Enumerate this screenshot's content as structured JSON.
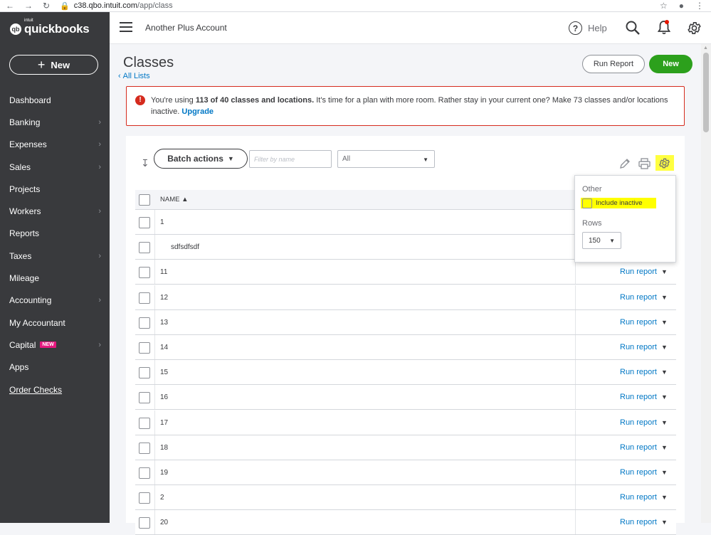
{
  "browser": {
    "host": "c38.qbo.intuit.com",
    "path": "/app/class"
  },
  "brand": {
    "intuit": "intuit",
    "wordmark": "quickbooks",
    "badge": "qb"
  },
  "sidebar": {
    "new_label": "New",
    "items": [
      {
        "label": "Dashboard",
        "chevron": false
      },
      {
        "label": "Banking",
        "chevron": true
      },
      {
        "label": "Expenses",
        "chevron": true
      },
      {
        "label": "Sales",
        "chevron": true
      },
      {
        "label": "Projects",
        "chevron": false
      },
      {
        "label": "Workers",
        "chevron": true
      },
      {
        "label": "Reports",
        "chevron": false
      },
      {
        "label": "Taxes",
        "chevron": true
      },
      {
        "label": "Mileage",
        "chevron": false
      },
      {
        "label": "Accounting",
        "chevron": true
      },
      {
        "label": "My Accountant",
        "chevron": false
      },
      {
        "label": "Capital",
        "chevron": true,
        "badge": "NEW"
      },
      {
        "label": "Apps",
        "chevron": false
      },
      {
        "label": "Order Checks",
        "chevron": false,
        "underline": true
      }
    ]
  },
  "header": {
    "company": "Another Plus Account",
    "help": "Help"
  },
  "page": {
    "title": "Classes",
    "all_lists": "All Lists",
    "run_report": "Run Report",
    "new": "New"
  },
  "alert": {
    "pre": "You're using ",
    "bold": "113 of 40 classes and locations.",
    "post": " It's time for a plan with more room. Rather stay in your current one? Make 73 classes and/or locations inactive. ",
    "link": "Upgrade"
  },
  "toolbar": {
    "batch_actions": "Batch actions",
    "filter_placeholder": "Filter by name",
    "status_selected": "All"
  },
  "table": {
    "name_header": "NAME",
    "run_report": "Run report",
    "rows": [
      {
        "name": "1",
        "sub": false,
        "action": false
      },
      {
        "name": "sdfsdfsdf",
        "sub": true,
        "action": false
      },
      {
        "name": "11",
        "sub": false,
        "action": true
      },
      {
        "name": "12",
        "sub": false,
        "action": true
      },
      {
        "name": "13",
        "sub": false,
        "action": true
      },
      {
        "name": "14",
        "sub": false,
        "action": true
      },
      {
        "name": "15",
        "sub": false,
        "action": true
      },
      {
        "name": "16",
        "sub": false,
        "action": true
      },
      {
        "name": "17",
        "sub": false,
        "action": true
      },
      {
        "name": "18",
        "sub": false,
        "action": true
      },
      {
        "name": "19",
        "sub": false,
        "action": true
      },
      {
        "name": "2",
        "sub": false,
        "action": true
      },
      {
        "name": "20",
        "sub": false,
        "action": true
      }
    ]
  },
  "settings_popup": {
    "other": "Other",
    "include_inactive": "Include inactive",
    "rows": "Rows",
    "rows_value": "150"
  },
  "colors": {
    "sidebar_bg": "#393a3d",
    "link": "#0077c5",
    "green": "#2ca01c",
    "alert": "#d52b1e",
    "highlight": "#ffff00"
  }
}
